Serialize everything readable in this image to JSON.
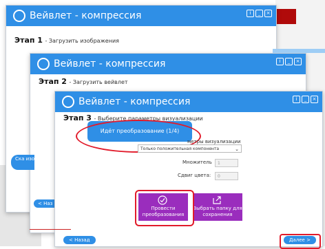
{
  "windows": {
    "title": "Вейвлет - компрессия",
    "step1": {
      "label": "Этап 1",
      "text": "- Загрузить изображения"
    },
    "step2": {
      "label": "Этап 2",
      "text": "- Загрузить вейвлет"
    },
    "step3": {
      "label": "Этап 3",
      "text": "- Выберите параметры визуализации"
    }
  },
  "left_buttons": {
    "load_partial": "Ска изобра",
    "back_partial": "< Наз"
  },
  "progress": {
    "text": "Идёт преобразование (1/4)",
    "done": 1,
    "total": 4
  },
  "viz": {
    "label_partial": "метры визуализации",
    "select_value": "Только положительная компонента",
    "multiplier_label": "Множитель",
    "multiplier_value": "1",
    "shift_label": "Сдвиг цвета:",
    "shift_value": "0"
  },
  "actions": {
    "convert": "Провести преобразования",
    "choose_folder": "Выбрать папку для сохранения"
  },
  "nav": {
    "back": "< Назад",
    "next": "Далее >"
  },
  "colors": {
    "accent": "#2f8fe6",
    "tile": "#9a2dbd",
    "highlight": "#e11a2a"
  }
}
